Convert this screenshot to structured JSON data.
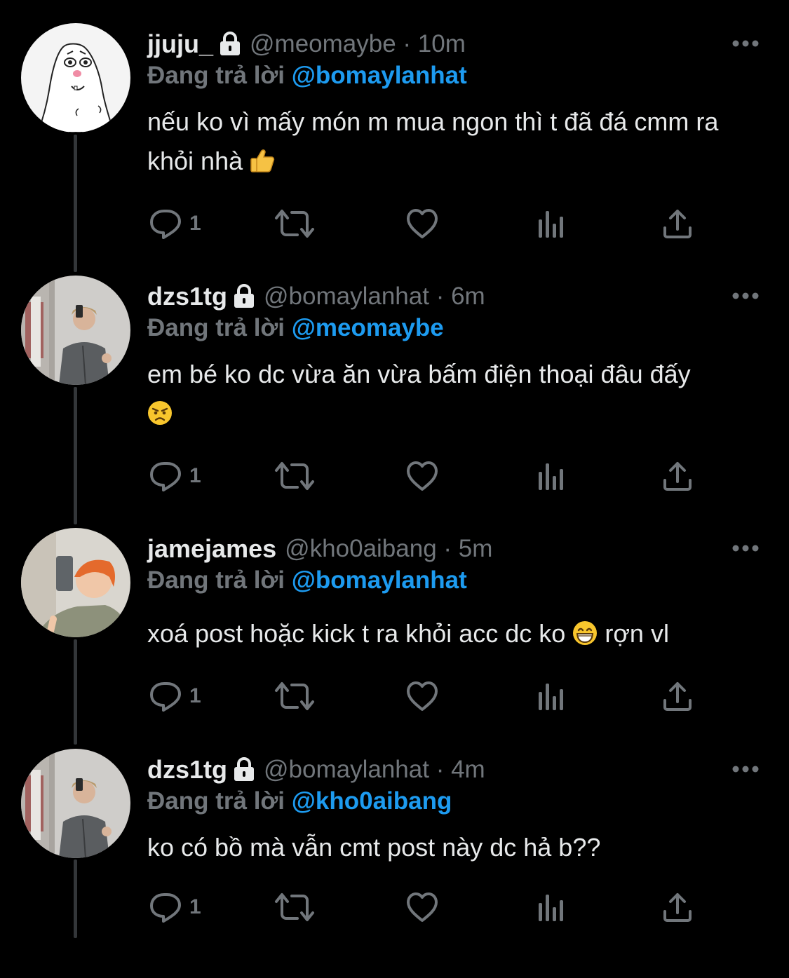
{
  "colors": {
    "background": "#000000",
    "text": "#e7e9ea",
    "muted": "#71767b",
    "accent": "#1d9bf0"
  },
  "tweets": [
    {
      "display_name": "jjuju_",
      "handle": "@meomaybe",
      "time": "10m",
      "locked": true,
      "replying_label": "Đang trả lời",
      "replying_to": "@bomaylanhat",
      "text": "nếu ko vì mấy món m mua ngon thì t đã đá cmm ra khỏi nhà",
      "emoji": "thumbs-up",
      "reply_count": "1",
      "avatar": "drawn-meme-face"
    },
    {
      "display_name": "dzs1tg",
      "handle": "@bomaylanhat",
      "time": "6m",
      "locked": true,
      "replying_label": "Đang trả lời",
      "replying_to": "@meomaybe",
      "text": "em bé ko dc vừa ăn vừa bấm điện thoại đâu đấy",
      "emoji": "angry-face",
      "reply_count": "1",
      "avatar": "mirror-selfie-gray-hoodie"
    },
    {
      "display_name": "jamejames",
      "handle": "@kho0aibang",
      "time": "5m",
      "locked": false,
      "replying_label": "Đang trả lời",
      "replying_to": "@bomaylanhat",
      "text_before_emoji": "xoá post hoặc kick t ra khỏi acc dc ko",
      "emoji": "grinning-face",
      "text_after_emoji": "rợn vl",
      "reply_count": "1",
      "avatar": "mirror-selfie-orange-hair"
    },
    {
      "display_name": "dzs1tg",
      "handle": "@bomaylanhat",
      "time": "4m",
      "locked": true,
      "replying_label": "Đang trả lời",
      "replying_to": "@kho0aibang",
      "text": "ko có bồ mà vẫn cmt post này dc hả b??",
      "reply_count": "1",
      "avatar": "mirror-selfie-gray-hoodie"
    }
  ],
  "icons": {
    "reply": "reply-icon",
    "retweet": "retweet-icon",
    "like": "heart-icon",
    "views": "analytics-icon",
    "share": "share-icon",
    "more": "more-options-icon",
    "lock": "lock-icon"
  }
}
